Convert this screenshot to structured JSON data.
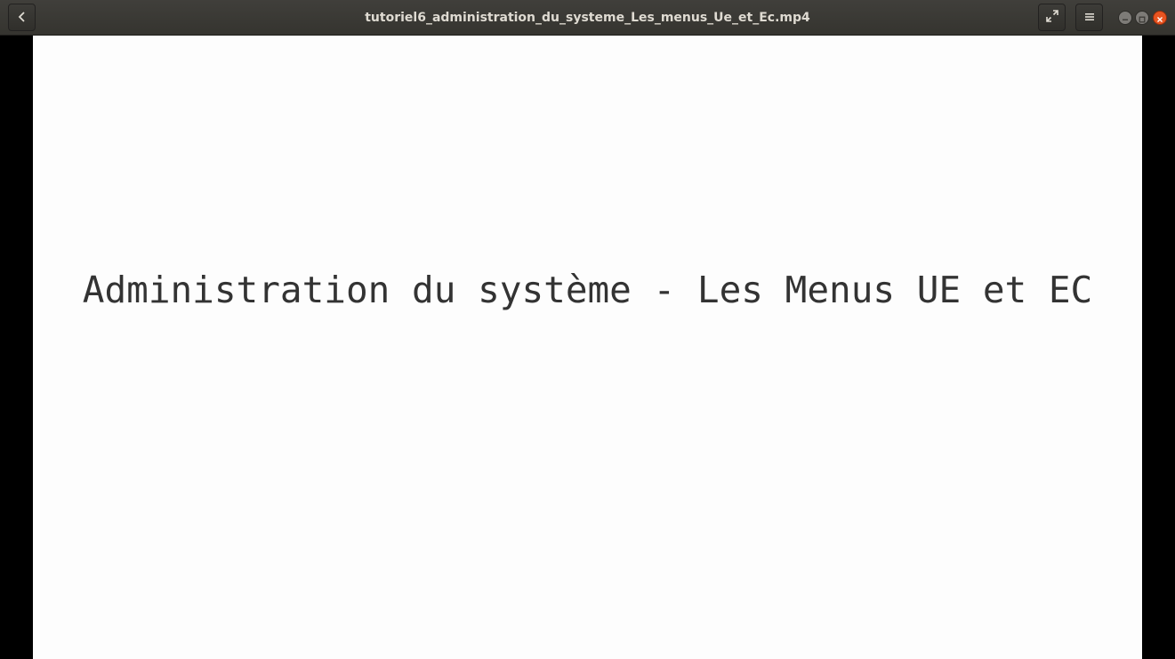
{
  "window": {
    "title": "tutoriel6_administration_du_systeme_Les_menus_Ue_et_Ec.mp4"
  },
  "headerbar": {
    "back_icon": "chevron-left-icon",
    "fullscreen_icon": "fullscreen-icon",
    "menu_icon": "hamburger-menu-icon"
  },
  "window_controls": {
    "minimize_icon": "minimize-icon",
    "maximize_icon": "maximize-icon",
    "close_icon": "close-icon",
    "close_color": "#e95420"
  },
  "video": {
    "slide_title": "Administration du système - Les Menus UE et EC"
  }
}
